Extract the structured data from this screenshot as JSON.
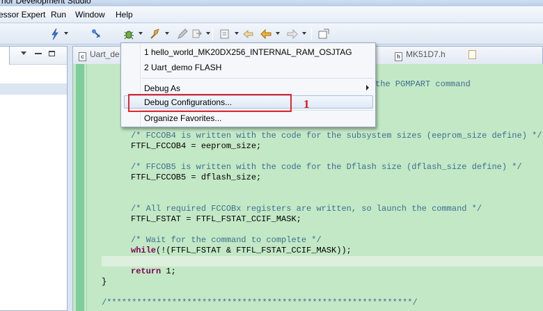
{
  "window": {
    "title": "rrior Development Studio"
  },
  "menubar": {
    "items": [
      "essor Expert",
      "Run",
      "Window",
      "Help"
    ]
  },
  "toolbar": {
    "icons": [
      "lightning-icon",
      "pin-icon",
      "debug-bug-icon",
      "run-icon",
      "pencil-icon",
      "step-icon",
      "build-icon",
      "back-icon",
      "forward-icon",
      "open-perspective-icon"
    ]
  },
  "editor": {
    "tabs": [
      {
        "label": "Uart_de",
        "icon": "c"
      },
      {
        "label": "MK51D7.h",
        "icon": "h"
      }
    ],
    "code_lines": [
      {
        "text": "the PGMPART command",
        "type": "comment"
      },
      {
        "text": "/* FCCOB4 is written with the code for the subsystem sizes (eeprom_size define) */",
        "type": "comment"
      },
      {
        "text": "FTFL_FCCOB4 = eeprom_size;",
        "type": "code"
      },
      {
        "text": "/* FFCOB5 is written with the code for the Dflash size (dflash_size define) */",
        "type": "comment"
      },
      {
        "text": "FTFL_FCCOB5 = dflash_size;",
        "type": "code"
      },
      {
        "text": "/* All required FCCOBx registers are written, so launch the command */",
        "type": "comment"
      },
      {
        "text": "FTFL_FSTAT = FTFL_FSTAT_CCIF_MASK;",
        "type": "code"
      },
      {
        "text": "/* Wait for the command to complete */",
        "type": "comment"
      },
      {
        "text_kw": "while",
        "text_rest": "(!(FTFL_FSTAT & FTFL_FSTAT_CCIF_MASK));",
        "type": "kw"
      },
      {
        "text_kw": "return",
        "text_rest": " 1;",
        "type": "kw"
      },
      {
        "text": "}",
        "type": "code"
      },
      {
        "text": "/*************************************************************/",
        "type": "comment"
      }
    ]
  },
  "dropdown": {
    "recent": [
      "1 hello_world_MK20DX256_INTERNAL_RAM_OSJTAG",
      "2 Uart_demo FLASH"
    ],
    "debug_as": "Debug As",
    "debug_configurations": "Debug Configurations...",
    "organize_favorites": "Organize Favorites..."
  },
  "annotation": {
    "number": "1",
    "color": "#e0262f"
  }
}
